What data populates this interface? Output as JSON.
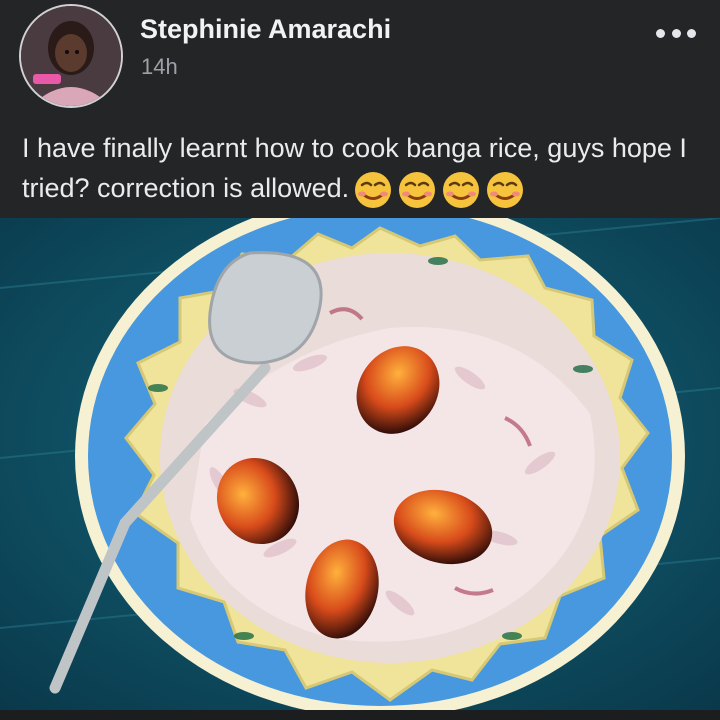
{
  "post": {
    "author": "Stephinie Amarachi",
    "timestamp": "14h",
    "caption": "I have finally learnt how to cook banga rice, guys hope I tried? correction is allowed.",
    "emoji_count": 4,
    "emoji_name": "sly-smile-emoji",
    "avatar_icon": "profile-photo-avatar",
    "menu_icon": "more-options-icon",
    "photo_description_icon": "banga-rice-plate-photo"
  },
  "colors": {
    "background": "#242526",
    "text": "#e4e6eb",
    "secondary_text": "#9ea2a8",
    "tablecloth": "#0d4f62",
    "plate_rim": "#3f8fd6",
    "plate_inner": "#f0e39a",
    "rice": "#f1dfe3",
    "palm_nut": "#d94a1f"
  }
}
